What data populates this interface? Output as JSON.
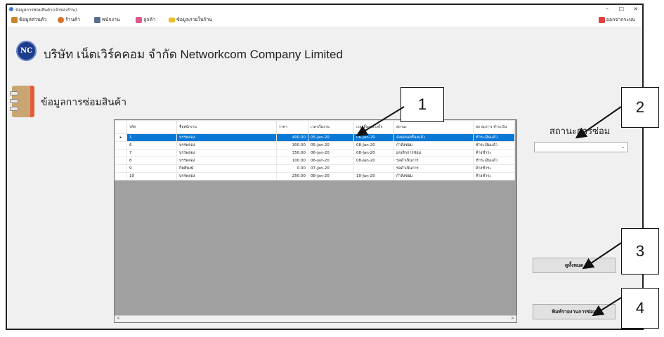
{
  "window": {
    "title": "ข้อมูลการซ่อมสินค้า(เจ้าของร้าน)",
    "minimize": "–",
    "maximize": "□",
    "close": "×"
  },
  "menu": {
    "items": [
      {
        "label": "ข้อมูลส่วนตัว",
        "icon": "person-icon",
        "color": "#c9862f"
      },
      {
        "label": "ร้านค้า",
        "icon": "shop-icon",
        "color": "#d8742a"
      },
      {
        "label": "พนักงาน",
        "icon": "employee-icon",
        "color": "#5a6e8c"
      },
      {
        "label": "ลูกค้า",
        "icon": "customer-icon",
        "color": "#d85a8c"
      },
      {
        "label": "ข้อมูลภายในร้าน",
        "icon": "folder-icon",
        "color": "#e8c02a"
      }
    ],
    "logout": {
      "label": "ออกจากระบบ",
      "icon": "exit-icon",
      "color": "#e0403a"
    }
  },
  "header": {
    "logo_text": "NC",
    "company": "บริษัท เน็ตเวิร์คคอม จำกัด   Networkcom Company Limited"
  },
  "section": {
    "title": "ข้อมูลการซ่อมสินค้า",
    "icon": "book-icon"
  },
  "grid": {
    "columns": [
      "รหัส",
      "ชื่อพนักงาน",
      "ราคา",
      "เวลาเริ่มงาน",
      "เวลาสิ้นงาน เสร็จ",
      "สถานะ",
      "สถานะการ ชำระเงิน"
    ],
    "rows": [
      {
        "id": "1",
        "employee": "บรรพลอง",
        "price": "400.00",
        "start": "05-Jan-20",
        "end": "06-Jan-20",
        "status": "ส่งมอบเครื่องแล้ว",
        "payment": "ชำระเงินแล้ว",
        "selected": true
      },
      {
        "id": "6",
        "employee": "บรรพลอง",
        "price": "300.00",
        "start": "05-Jan-20",
        "end": "08-Jan-20",
        "status": "กำลังซ่อม",
        "payment": "ชำระเงินแล้ว",
        "selected": false
      },
      {
        "id": "7",
        "employee": "บรรพลอง",
        "price": "350.00",
        "start": "06-Jan-20",
        "end": "08-Jan-20",
        "status": "ยกเลิกการซ่อม",
        "payment": "ค้างชำระ",
        "selected": false
      },
      {
        "id": "8",
        "employee": "บรรพลอง",
        "price": "100.00",
        "start": "06-Jan-20",
        "end": "08-Jan-20",
        "status": "รอดำเนินการ",
        "payment": "ชำระเงินแล้ว",
        "selected": false
      },
      {
        "id": "9",
        "employee": "กิตติพงษ์",
        "price": "0.00",
        "start": "07-Jan-20",
        "end": "",
        "status": "รอดำเนินการ",
        "payment": "ค้างชำระ",
        "selected": false
      },
      {
        "id": "10",
        "employee": "บรรพลอง",
        "price": "250.00",
        "start": "08-Jan-20",
        "end": "10-Jan-20",
        "status": "กำลังซ่อม",
        "payment": "ค้างชำระ",
        "selected": false
      }
    ],
    "row_pointer": "▸",
    "scroll_left": "<",
    "scroll_right": ">"
  },
  "filter": {
    "label": "สถานะการซ่อม",
    "value": ""
  },
  "buttons": {
    "show_all": "ดูทั้งหมด",
    "print_report": "พิมพ์รายงานการซ่อม"
  },
  "callouts": [
    "1",
    "2",
    "3",
    "4"
  ]
}
